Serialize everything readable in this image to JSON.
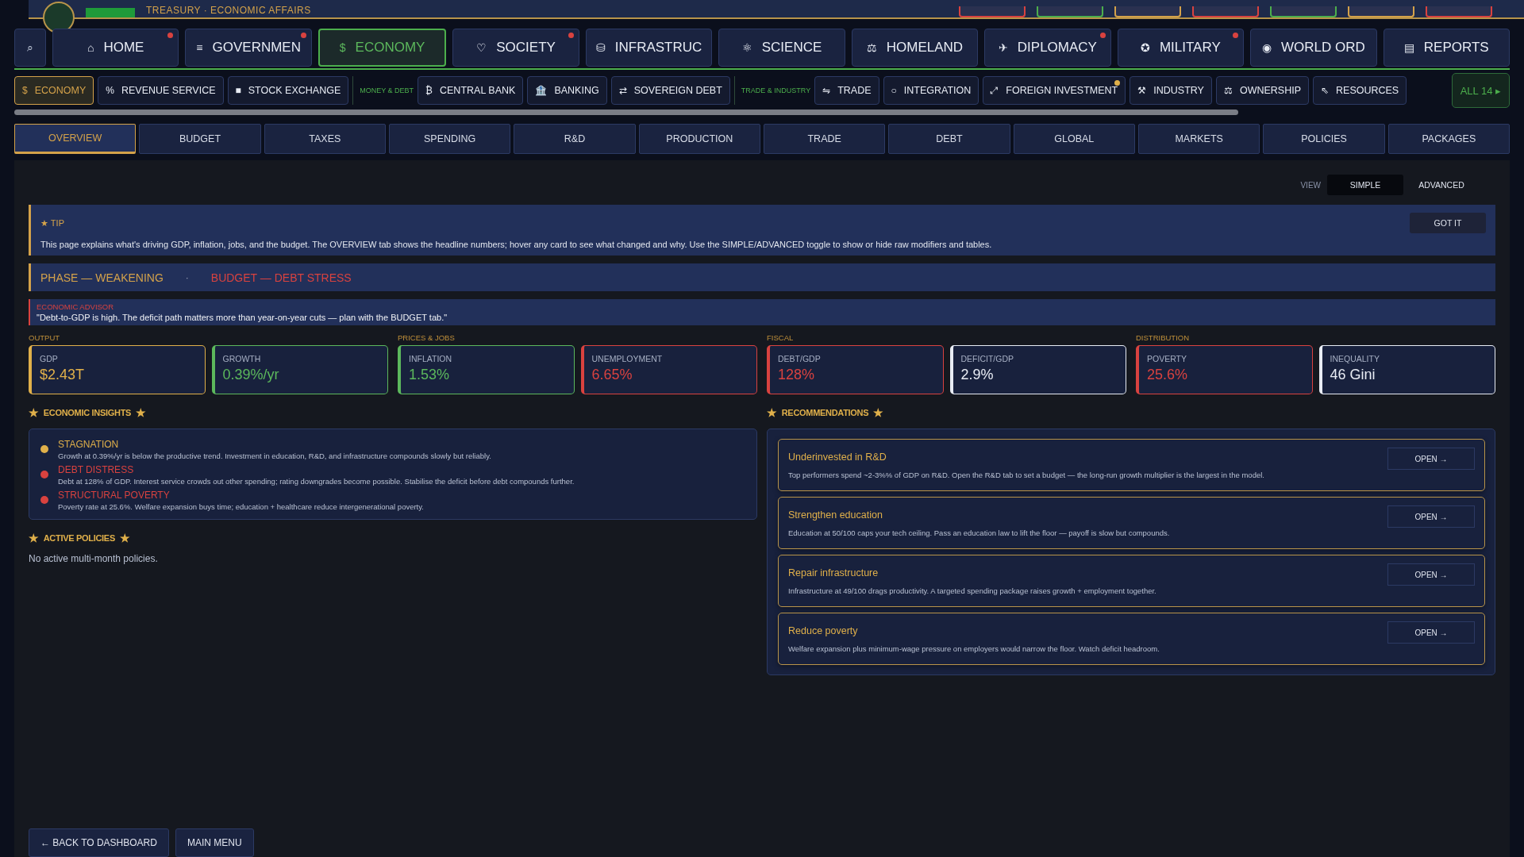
{
  "header": {
    "subtitle": "TREASURY · ECONOMIC AFFAIRS"
  },
  "nav": {
    "search_icon": "⌕",
    "tabs": [
      {
        "icon": "⌂",
        "label": "HOME",
        "selected": false,
        "alert": true
      },
      {
        "icon": "≡",
        "label": "GOVERNMEN",
        "selected": false,
        "alert": true
      },
      {
        "icon": "$",
        "label": "ECONOMY",
        "selected": true,
        "alert": false
      },
      {
        "icon": "♡",
        "label": "SOCIETY",
        "selected": false,
        "alert": true
      },
      {
        "icon": "⛁",
        "label": "INFRASTRUC",
        "selected": false,
        "alert": false
      },
      {
        "icon": "⚛",
        "label": "SCIENCE",
        "selected": false,
        "alert": false
      },
      {
        "icon": "⚖",
        "label": "HOMELAND",
        "selected": false,
        "alert": false
      },
      {
        "icon": "✈",
        "label": "DIPLOMACY",
        "selected": false,
        "alert": true
      },
      {
        "icon": "✪",
        "label": "MILITARY",
        "selected": false,
        "alert": true
      },
      {
        "icon": "◉",
        "label": "WORLD ORD",
        "selected": false,
        "alert": false
      },
      {
        "icon": "▤",
        "label": "REPORTS",
        "selected": false,
        "alert": false
      }
    ]
  },
  "subnav": {
    "items": [
      {
        "kind": "tab",
        "icon": "$",
        "label": "ECONOMY",
        "selected": true,
        "alert": false
      },
      {
        "kind": "tab",
        "icon": "%",
        "label": "REVENUE SERVICE",
        "selected": false,
        "alert": false
      },
      {
        "kind": "tab",
        "icon": "■",
        "label": "STOCK EXCHANGE",
        "selected": false,
        "alert": false
      },
      {
        "kind": "group",
        "label": "MONEY & DEBT"
      },
      {
        "kind": "tab",
        "icon": "₿",
        "label": "CENTRAL BANK",
        "selected": false,
        "alert": false
      },
      {
        "kind": "tab",
        "icon": "🏦",
        "label": "BANKING",
        "selected": false,
        "alert": false
      },
      {
        "kind": "tab",
        "icon": "⇄",
        "label": "SOVEREIGN DEBT",
        "selected": false,
        "alert": false
      },
      {
        "kind": "group",
        "label": "TRADE & INDUSTRY"
      },
      {
        "kind": "tab",
        "icon": "⇋",
        "label": "TRADE",
        "selected": false,
        "alert": false
      },
      {
        "kind": "tab",
        "icon": "○",
        "label": "INTEGRATION",
        "selected": false,
        "alert": false
      },
      {
        "kind": "tab",
        "icon": "⤢",
        "label": "FOREIGN INVESTMENT",
        "selected": false,
        "alert": true
      },
      {
        "kind": "tab",
        "icon": "⚒",
        "label": "INDUSTRY",
        "selected": false,
        "alert": false
      },
      {
        "kind": "tab",
        "icon": "⚖",
        "label": "OWNERSHIP",
        "selected": false,
        "alert": false
      },
      {
        "kind": "tab",
        "icon": "⇖",
        "label": "RESOURCES",
        "selected": false,
        "alert": false
      }
    ],
    "all_button": "ALL 14 ▸"
  },
  "page_tabs": [
    {
      "label": "OVERVIEW",
      "selected": true
    },
    {
      "label": "BUDGET",
      "selected": false
    },
    {
      "label": "TAXES",
      "selected": false
    },
    {
      "label": "SPENDING",
      "selected": false
    },
    {
      "label": "R&D",
      "selected": false
    },
    {
      "label": "PRODUCTION",
      "selected": false
    },
    {
      "label": "TRADE",
      "selected": false
    },
    {
      "label": "DEBT",
      "selected": false
    },
    {
      "label": "GLOBAL",
      "selected": false
    },
    {
      "label": "MARKETS",
      "selected": false
    },
    {
      "label": "POLICIES",
      "selected": false
    },
    {
      "label": "PACKAGES",
      "selected": false
    }
  ],
  "view": {
    "label": "VIEW",
    "options": [
      {
        "label": "SIMPLE",
        "selected": true
      },
      {
        "label": "ADVANCED",
        "selected": false
      }
    ]
  },
  "tip": {
    "icon": "★",
    "title": "TIP",
    "text": "This page explains what's driving GDP, inflation, jobs, and the budget. The OVERVIEW tab shows the headline numbers; hover any card to see what changed and why. Use the SIMPLE/ADVANCED toggle to show or hide raw modifiers and tables.",
    "button": "GOT IT"
  },
  "status": {
    "phase": "PHASE — WEAKENING",
    "separator": "·",
    "budget": "BUDGET — DEBT STRESS"
  },
  "advisor": {
    "title": "ECONOMIC ADVISOR",
    "quote": "\"Debt-to-GDP is high. The deficit path matters more than year-on-year cuts — plan with the BUDGET tab.\""
  },
  "metric_groups": [
    {
      "label": "OUTPUT",
      "cards": [
        {
          "label": "GDP",
          "value": "$2.43T",
          "color": "#e0b04a"
        },
        {
          "label": "GROWTH",
          "value": "0.39%/yr",
          "color": "#5cb85c"
        }
      ]
    },
    {
      "label": "PRICES & JOBS",
      "cards": [
        {
          "label": "INFLATION",
          "value": "1.53%",
          "color": "#5cb85c"
        },
        {
          "label": "UNEMPLOYMENT",
          "value": "6.65%",
          "color": "#d9423f"
        }
      ]
    },
    {
      "label": "FISCAL",
      "cards": [
        {
          "label": "DEBT/GDP",
          "value": "128%",
          "color": "#d9423f"
        },
        {
          "label": "DEFICIT/GDP",
          "value": "2.9%",
          "color": "#e8ecf4"
        }
      ]
    },
    {
      "label": "DISTRIBUTION",
      "cards": [
        {
          "label": "POVERTY",
          "value": "25.6%",
          "color": "#d9423f"
        },
        {
          "label": "INEQUALITY",
          "value": "46 Gini",
          "color": "#e8ecf4"
        }
      ]
    }
  ],
  "insights": {
    "star": "★",
    "title": "ECONOMIC INSIGHTS",
    "items": [
      {
        "title": "STAGNATION",
        "text": "Growth at 0.39%/yr is below the productive trend. Investment in education, R&D, and infrastructure compounds slowly but reliably.",
        "color": "#e0b04a"
      },
      {
        "title": "DEBT DISTRESS",
        "text": "Debt at 128% of GDP. Interest service crowds out other spending; rating downgrades become possible. Stabilise the deficit before debt compounds further.",
        "color": "#d9423f"
      },
      {
        "title": "STRUCTURAL POVERTY",
        "text": "Poverty rate at 25.6%. Welfare expansion buys time; education + healthcare reduce intergenerational poverty.",
        "color": "#d9423f"
      }
    ]
  },
  "active_policies": {
    "star": "★",
    "title": "ACTIVE POLICIES",
    "empty_text": "No active multi-month policies."
  },
  "recommendations": {
    "star": "★",
    "title": "RECOMMENDATIONS",
    "items": [
      {
        "title": "Underinvested in R&D",
        "text": "Top performers spend ~2-3%% of GDP on R&D. Open the R&D tab to set a budget — the long-run growth multiplier is the largest in the model.",
        "button": "OPEN →"
      },
      {
        "title": "Strengthen education",
        "text": "Education at 50/100 caps your tech ceiling. Pass an education law to lift the floor — payoff is slow but compounds.",
        "button": "OPEN →"
      },
      {
        "title": "Repair infrastructure",
        "text": "Infrastructure at 49/100 drags productivity. A targeted spending package raises growth + employment together.",
        "button": "OPEN →"
      },
      {
        "title": "Reduce poverty",
        "text": "Welfare expansion plus minimum-wage pressure on employers would narrow the floor. Watch deficit headroom.",
        "button": "OPEN →"
      }
    ]
  },
  "footer": {
    "buttons": [
      "← BACK TO DASHBOARD",
      "MAIN MENU"
    ]
  }
}
